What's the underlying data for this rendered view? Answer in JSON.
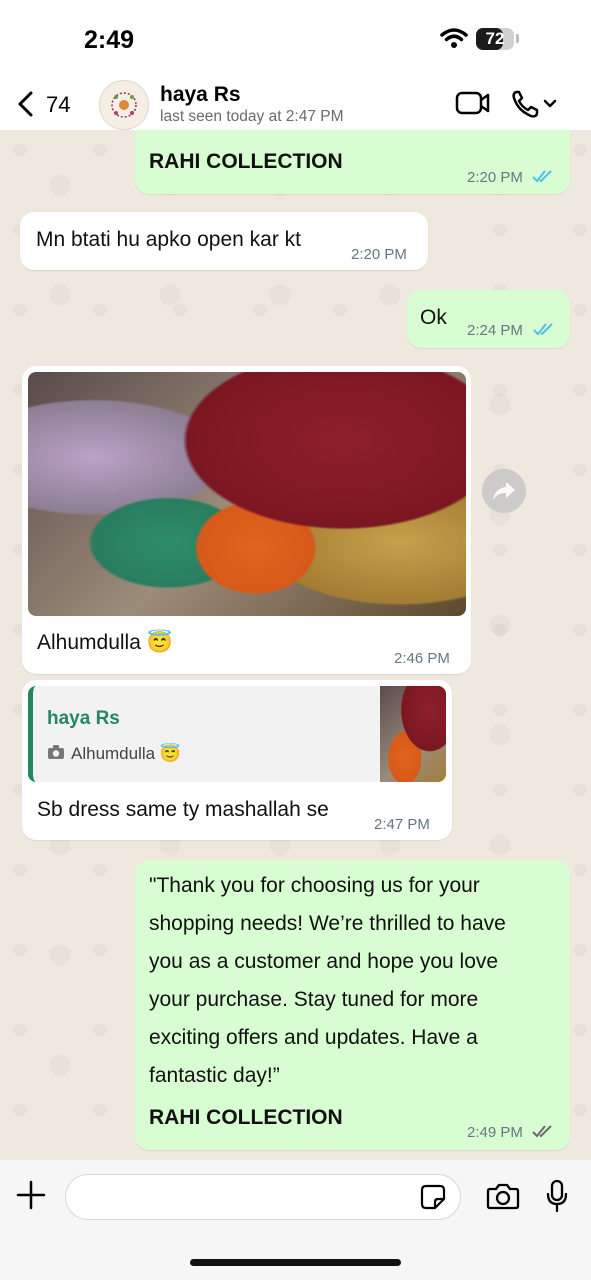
{
  "status_bar": {
    "time": "2:49",
    "battery": "72",
    "battery_level": 0.72
  },
  "header": {
    "back_count": "74",
    "contact_name": "haya Rs",
    "last_seen": "last seen today at 2:47 PM"
  },
  "messages": [
    {
      "direction": "out",
      "text": "RAHI COLLECTION",
      "time": "2:20 PM",
      "status": "read"
    },
    {
      "direction": "in",
      "text": "Mn btati hu apko open kar kt",
      "time": "2:20 PM"
    },
    {
      "direction": "out",
      "text": "Ok",
      "time": "2:24 PM",
      "status": "read"
    },
    {
      "direction": "in",
      "type": "image",
      "caption": "Alhumdulla 😇",
      "time": "2:46 PM"
    },
    {
      "direction": "in",
      "type": "reply",
      "quoted_name": "haya Rs",
      "quoted_text": "Alhumdulla 😇",
      "text": "Sb dress same ty mashallah se",
      "time": "2:47 PM"
    },
    {
      "direction": "out",
      "lines": [
        "\"Thank you for choosing us for your",
        "shopping needs! We’re thrilled to have",
        "you as a customer and hope you love",
        "your purchase. Stay tuned for more",
        "exciting offers and updates. Have a",
        "fantastic day!”"
      ],
      "signature": "RAHI COLLECTION",
      "time": "2:49 PM",
      "status": "delivered"
    }
  ],
  "input": {
    "placeholder": ""
  },
  "colors": {
    "outgoing": "#d9fdd3",
    "incoming": "#ffffff",
    "read_tick": "#53bdeb",
    "accent": "#25875f"
  },
  "icons": [
    "wifi-icon",
    "back-chevron-icon",
    "video-call-icon",
    "phone-call-icon",
    "forward-icon",
    "camera-icon",
    "plus-icon",
    "sticker-icon",
    "microphone-icon"
  ]
}
